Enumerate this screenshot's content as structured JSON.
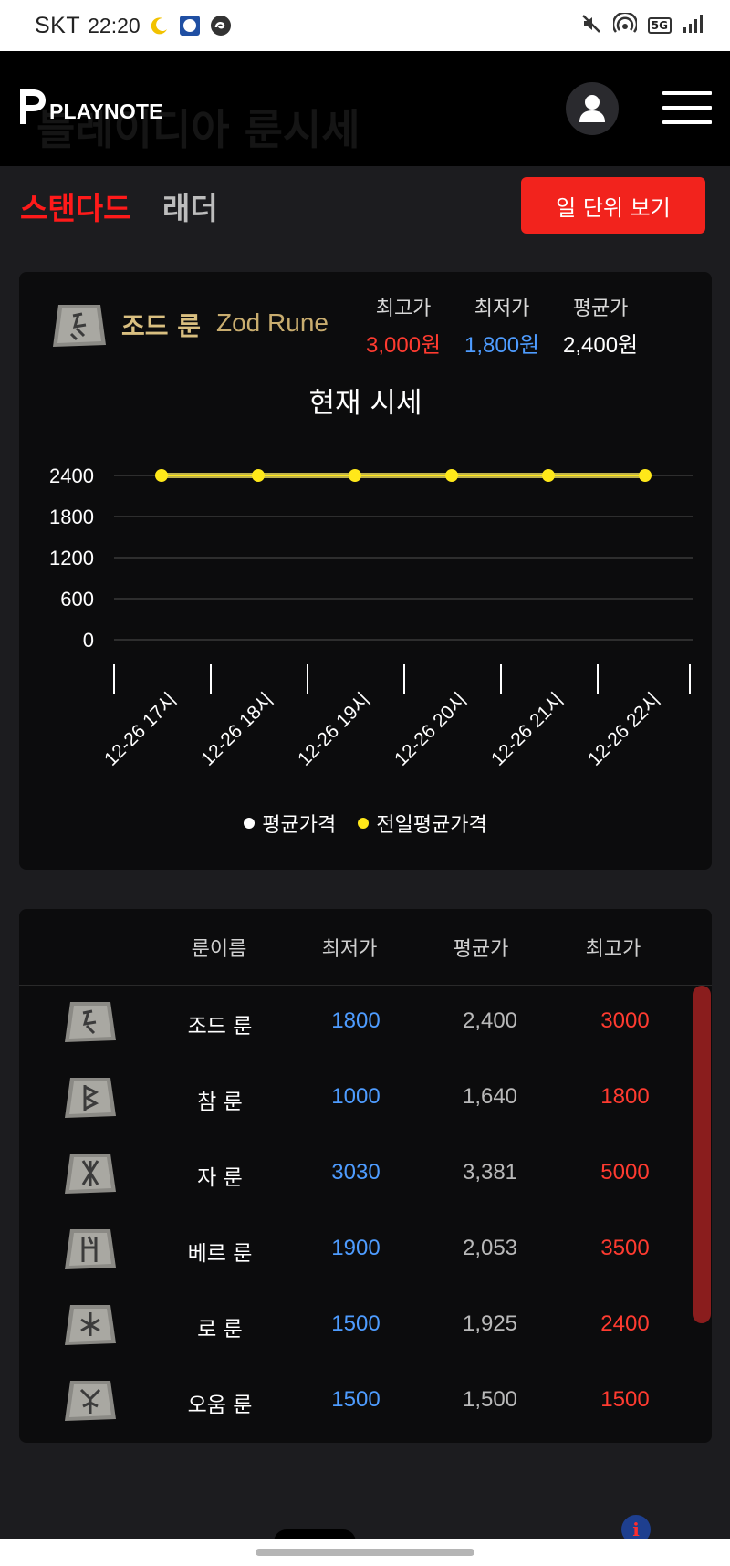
{
  "status_bar": {
    "carrier": "SKT",
    "time": "22:20",
    "network": "5G"
  },
  "header": {
    "logo_text": "PLAYNOTE",
    "ghost_title": "블레이디아 룬시세"
  },
  "tabs": {
    "active_label": "스탠다드",
    "inactive_label": "래더"
  },
  "daily_view_button": "일 단위 보기",
  "summary": {
    "rune_name_kr": "조드 룬",
    "rune_name_en": "Zod Rune",
    "max_label": "최고가",
    "max_value": "3,000원",
    "min_label": "최저가",
    "min_value": "1,800원",
    "avg_label": "평균가",
    "avg_value": "2,400원"
  },
  "chart_title": "현재 시세",
  "chart_data": {
    "type": "line",
    "title": "현재 시세",
    "x": [
      "12-26 17시",
      "12-26 18시",
      "12-26 19시",
      "12-26 20시",
      "12-26 21시",
      "12-26 22시"
    ],
    "y_ticks": [
      0,
      600,
      1200,
      1800,
      2400
    ],
    "ylim": [
      0,
      2400
    ],
    "series": [
      {
        "name": "평균가격",
        "color": "#ffffff",
        "values": [
          2400,
          2400,
          2400,
          2400,
          2400,
          2400
        ]
      },
      {
        "name": "전일평균가격",
        "color": "#ffe81a",
        "values": [
          2400,
          2400,
          2400,
          2400,
          2400,
          2400
        ]
      }
    ],
    "grid": true,
    "legend_position": "bottom"
  },
  "table": {
    "headers": [
      "룬이름",
      "최저가",
      "평균가",
      "최고가"
    ],
    "rows": [
      {
        "icon": "zod-rune-icon",
        "name": "조드 룬",
        "low": "1800",
        "avg": "2,400",
        "high": "3000"
      },
      {
        "icon": "cham-rune-icon",
        "name": "참 룬",
        "low": "1000",
        "avg": "1,640",
        "high": "1800"
      },
      {
        "icon": "jah-rune-icon",
        "name": "자 룬",
        "low": "3030",
        "avg": "3,381",
        "high": "5000"
      },
      {
        "icon": "ber-rune-icon",
        "name": "베르 룬",
        "low": "1900",
        "avg": "2,053",
        "high": "3500"
      },
      {
        "icon": "lo-rune-icon",
        "name": "로 룬",
        "low": "1500",
        "avg": "1,925",
        "high": "2400"
      },
      {
        "icon": "ohm-rune-icon",
        "name": "오움 룬",
        "low": "1500",
        "avg": "1,500",
        "high": "1500"
      }
    ]
  },
  "colors": {
    "accent_red": "#f2231d",
    "max_red": "#ff3b30",
    "min_blue": "#4e9cff",
    "rune_gold": "#d9bf80",
    "prev_avg_yellow": "#ffe81a"
  }
}
